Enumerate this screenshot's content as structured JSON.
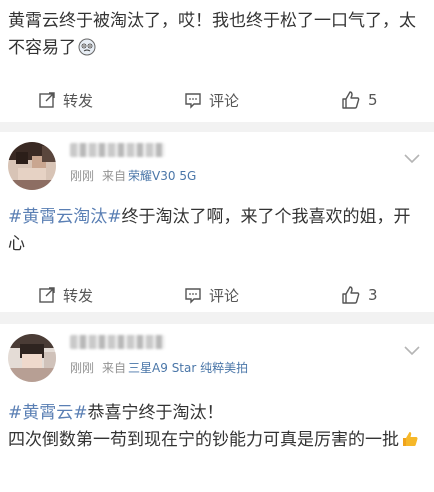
{
  "posts": [
    {
      "text": "黄霄云终于被淘汰了，哎！我也终于松了一口气了，太不容易了",
      "emoji": "emoji-face-icon",
      "actions": {
        "repost": "转发",
        "comment": "评论",
        "like_count": "5"
      }
    },
    {
      "time": "刚刚",
      "from_label": "来自",
      "device": "荣耀V30 5G",
      "hashtag": "#黄霄云淘汰#",
      "text": "终于淘汰了啊，来了个我喜欢的姐，开心",
      "actions": {
        "repost": "转发",
        "comment": "评论",
        "like_count": "3"
      }
    },
    {
      "time": "刚刚",
      "from_label": "来自",
      "device": "三星A9 Star 纯粹美拍",
      "hashtag": "#黄霄云#",
      "text_line1": "恭喜宁终于淘汰！",
      "text_line2": "四次倒数第一苟到现在宁的钞能力可真是厉害的一批",
      "emoji": "thumbs-up-icon"
    }
  ]
}
